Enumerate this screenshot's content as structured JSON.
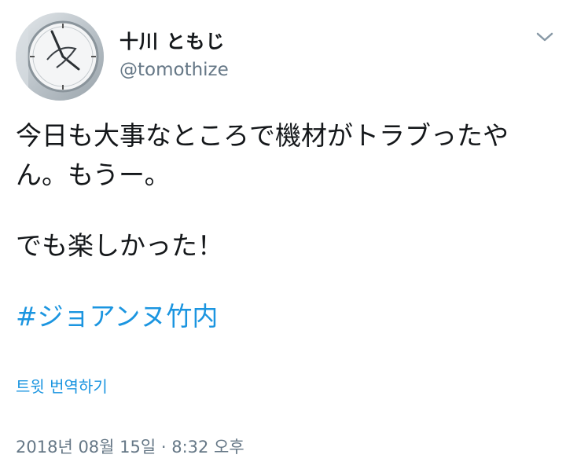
{
  "tweet": {
    "author": {
      "display_name": "十川 ともじ",
      "handle": "@tomothize",
      "avatar_icon": "clock-photo-avatar"
    },
    "menu_icon": "chevron-down-icon",
    "text_lines": [
      "今日も大事なところで機材がトラブったや",
      "ん。もうー。",
      "でも楽しかった！"
    ],
    "hashtag": "#ジョアンヌ竹内",
    "translate_label": "트윗 번역하기",
    "timestamp": "2018년 08월 15일 · 8:32 오후"
  },
  "colors": {
    "text": "#14171a",
    "secondary": "#657786",
    "link": "#1b95e0"
  }
}
